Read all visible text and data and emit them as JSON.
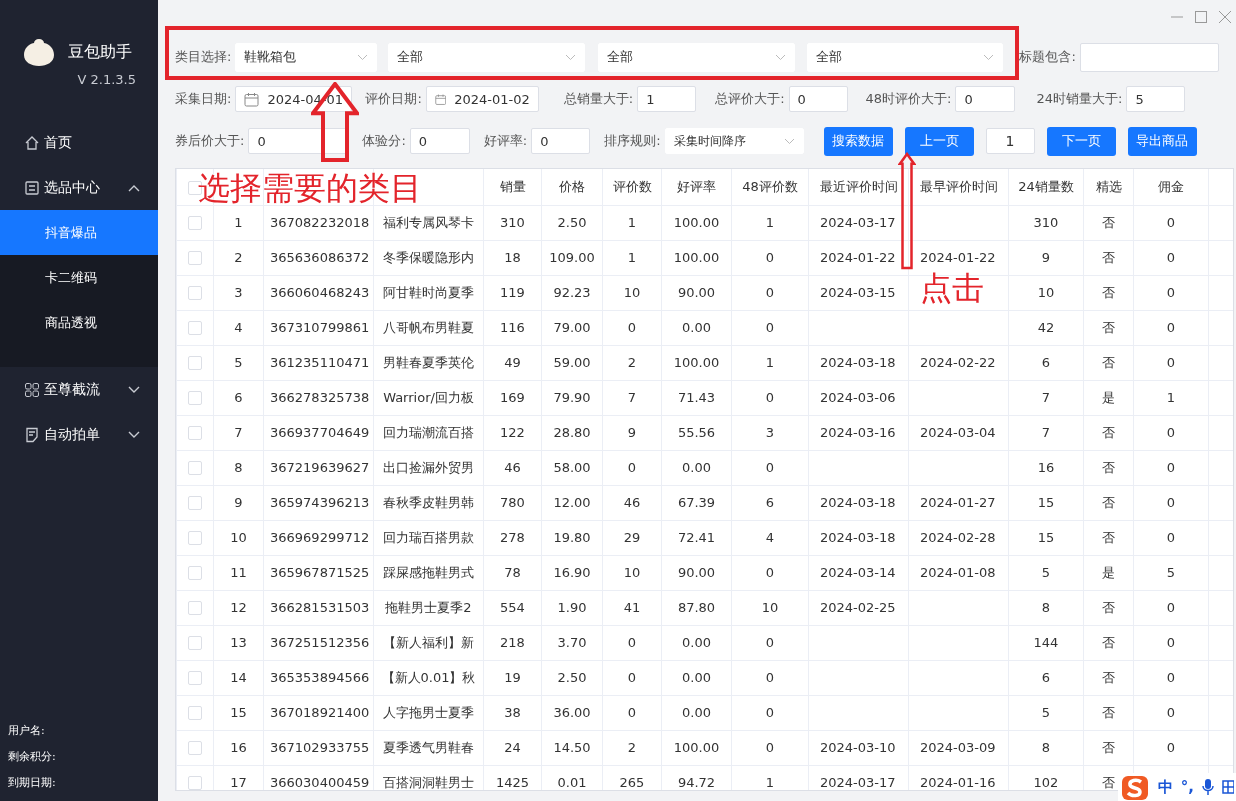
{
  "app": {
    "name": "豆包助手",
    "version": "V 2.1.3.5"
  },
  "sidebar": {
    "items": [
      {
        "label": "首页",
        "kind": "link"
      },
      {
        "label": "选品中心",
        "kind": "group",
        "expanded": true,
        "children": [
          {
            "label": "抖音爆品",
            "selected": true
          },
          {
            "label": "卡二维码",
            "selected": false
          },
          {
            "label": "商品透视",
            "selected": false
          }
        ]
      },
      {
        "label": "至尊截流",
        "kind": "group",
        "expanded": false
      },
      {
        "label": "自动拍单",
        "kind": "group",
        "expanded": false
      }
    ]
  },
  "account": [
    "用户名:",
    "剩余积分:",
    "到期日期:"
  ],
  "filters": [
    [
      {
        "kind": "select",
        "label": "类目选择:",
        "value": "鞋靴箱包"
      },
      {
        "kind": "select",
        "value": "全部"
      },
      {
        "kind": "select",
        "value": "全部"
      },
      {
        "kind": "select",
        "value": "全部"
      },
      {
        "kind": "input",
        "label": "标题包含:"
      }
    ],
    [
      {
        "kind": "date",
        "label": "采集日期:",
        "value": "2024-04-01"
      },
      {
        "kind": "date",
        "label": "评价日期:",
        "value": "2024-01-02"
      },
      {
        "kind": "input",
        "label": "总销量大于:",
        "value": "1"
      },
      {
        "kind": "input",
        "label": "总评价大于:",
        "value": "0"
      },
      {
        "kind": "input",
        "label": "48时评价大于:",
        "value": "0"
      },
      {
        "kind": "input",
        "label": "24时销量大于:",
        "value": "5"
      }
    ],
    [
      {
        "kind": "input",
        "label": "券后价大于:",
        "value": "0"
      },
      {
        "kind": "input",
        "label": "体验分:",
        "value": "0"
      },
      {
        "kind": "input",
        "label": "好评率:",
        "value": "0"
      },
      {
        "kind": "select",
        "label": "排序规则:",
        "value": "采集时间降序"
      },
      {
        "kind": "button",
        "value": "搜索数据"
      },
      {
        "kind": "button",
        "value": "上一页"
      },
      {
        "kind": "input",
        "value": "1"
      },
      {
        "kind": "button",
        "value": "下一页"
      },
      {
        "kind": "button",
        "value": "导出商品"
      }
    ]
  ],
  "table": {
    "header_checked": false,
    "columns": [
      null,
      null,
      null,
      "销量",
      "价格",
      "评价数",
      "好评率",
      "48评价数",
      "最近评价时间",
      "最早评价时间",
      "24销量数",
      "精选",
      "佣金"
    ],
    "rows": [
      {
        "checked": false,
        "cells": [
          "1",
          "367082232018",
          "福利专属风琴卡",
          "310",
          "2.50",
          "1",
          "100.00",
          "1",
          "2024-03-17",
          null,
          "310",
          "否",
          "0"
        ]
      },
      {
        "checked": false,
        "cells": [
          "2",
          "365636086372",
          "冬季保暖隐形内",
          "18",
          "109.00",
          "1",
          "100.00",
          "0",
          "2024-01-22",
          "2024-01-22",
          "9",
          "否",
          "0"
        ]
      },
      {
        "checked": false,
        "cells": [
          "3",
          "366060468243",
          "阿甘鞋时尚夏季",
          "119",
          "92.23",
          "10",
          "90.00",
          "0",
          "2024-03-15",
          null,
          "10",
          "否",
          "0"
        ]
      },
      {
        "checked": false,
        "cells": [
          "4",
          "367310799861",
          "八哥帆布男鞋夏",
          "116",
          "79.00",
          "0",
          "0.00",
          "0",
          null,
          null,
          "42",
          "否",
          "0"
        ]
      },
      {
        "checked": false,
        "cells": [
          "5",
          "361235110471",
          "男鞋春夏季英伦",
          "49",
          "59.00",
          "2",
          "100.00",
          "1",
          "2024-03-18",
          "2024-02-22",
          "6",
          "否",
          "0"
        ]
      },
      {
        "checked": false,
        "cells": [
          "6",
          "366278325738",
          "Warrior/回力板",
          "169",
          "79.90",
          "7",
          "71.43",
          "0",
          "2024-03-06",
          null,
          "7",
          "是",
          "1"
        ]
      },
      {
        "checked": false,
        "cells": [
          "7",
          "366937704649",
          "回力瑞潮流百搭",
          "122",
          "28.80",
          "9",
          "55.56",
          "3",
          "2024-03-16",
          "2024-03-04",
          "7",
          "否",
          "0"
        ]
      },
      {
        "checked": false,
        "cells": [
          "8",
          "367219639627",
          "出口捡漏外贸男",
          "46",
          "58.00",
          "0",
          "0.00",
          "0",
          null,
          null,
          "16",
          "否",
          "0"
        ]
      },
      {
        "checked": false,
        "cells": [
          "9",
          "365974396213",
          "春秋季皮鞋男韩",
          "780",
          "12.00",
          "46",
          "67.39",
          "6",
          "2024-03-18",
          "2024-01-27",
          "15",
          "否",
          "0"
        ]
      },
      {
        "checked": false,
        "cells": [
          "10",
          "366969299712",
          "回力瑞百搭男款",
          "278",
          "19.80",
          "29",
          "72.41",
          "4",
          "2024-03-18",
          "2024-02-28",
          "15",
          "否",
          "0"
        ]
      },
      {
        "checked": false,
        "cells": [
          "11",
          "365967871525",
          "踩屎感拖鞋男式",
          "78",
          "16.90",
          "10",
          "90.00",
          "0",
          "2024-03-14",
          "2024-01-08",
          "5",
          "是",
          "5"
        ]
      },
      {
        "checked": false,
        "cells": [
          "12",
          "366281531503",
          "拖鞋男士夏季2",
          "554",
          "1.90",
          "41",
          "87.80",
          "10",
          "2024-02-25",
          null,
          "8",
          "否",
          "0"
        ]
      },
      {
        "checked": false,
        "cells": [
          "13",
          "367251512356",
          "【新人福利】新",
          "218",
          "3.70",
          "0",
          "0.00",
          "0",
          null,
          null,
          "144",
          "否",
          "0"
        ]
      },
      {
        "checked": false,
        "cells": [
          "14",
          "365353894566",
          "【新人0.01】秋",
          "19",
          "2.50",
          "0",
          "0.00",
          "0",
          null,
          null,
          "6",
          "否",
          "0"
        ]
      },
      {
        "checked": false,
        "cells": [
          "15",
          "367018921400",
          "人字拖男士夏季",
          "38",
          "36.00",
          "0",
          "0.00",
          "0",
          null,
          null,
          "5",
          "否",
          "0"
        ]
      },
      {
        "checked": false,
        "cells": [
          "16",
          "367102933755",
          "夏季透气男鞋春",
          "24",
          "14.50",
          "2",
          "100.00",
          "0",
          "2024-03-10",
          "2024-03-09",
          "8",
          "否",
          "0"
        ]
      },
      {
        "checked": false,
        "cells": [
          "17",
          "366030400459",
          "百搭洞洞鞋男士",
          "1425",
          "0.01",
          "265",
          "94.72",
          "1",
          "2024-03-17",
          "2024-01-16",
          "102",
          "否",
          null
        ]
      }
    ]
  },
  "annotations": [
    {
      "kind": "box"
    },
    {
      "kind": "arrow"
    },
    {
      "kind": "label",
      "text": "选择需要的类目"
    },
    {
      "kind": "arrow"
    },
    {
      "kind": "label",
      "text": "点击"
    }
  ],
  "ime": {
    "mode": "中",
    "punctuation": "°,"
  }
}
